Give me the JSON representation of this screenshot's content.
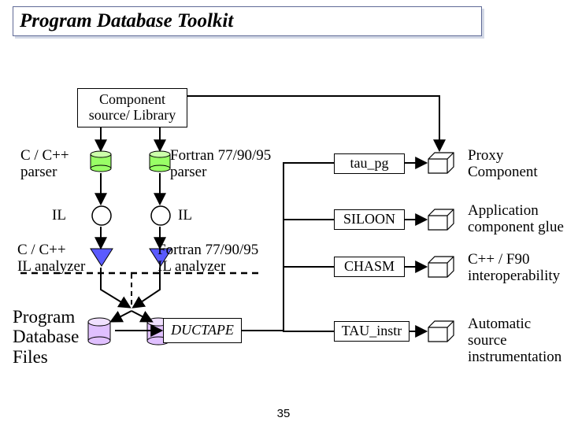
{
  "title": "Program Database Toolkit",
  "boxes": {
    "component": "Component\nsource/ Library",
    "tau_pg": "tau_pg",
    "siloon": "SILOON",
    "chasm": "CHASM",
    "tau_instr": "TAU_instr"
  },
  "labels": {
    "cparser": "C / C++\nparser",
    "fparser": "Fortran 77/90/95\nparser",
    "il1": "IL",
    "il2": "IL",
    "canalyzer": "C / C++\nIL analyzer",
    "fanalyzer": "Fortran 77/90/95\nIL analyzer",
    "pdf": "Program\nDatabase\nFiles",
    "ductape": "DUCTAPE",
    "proxy": "Proxy\nComponent",
    "appglue": "Application\ncomponent glue",
    "interop": "C++ / F90\ninteroperability",
    "autoinstr": "Automatic source\ninstrumentation"
  },
  "slide_number": "35"
}
